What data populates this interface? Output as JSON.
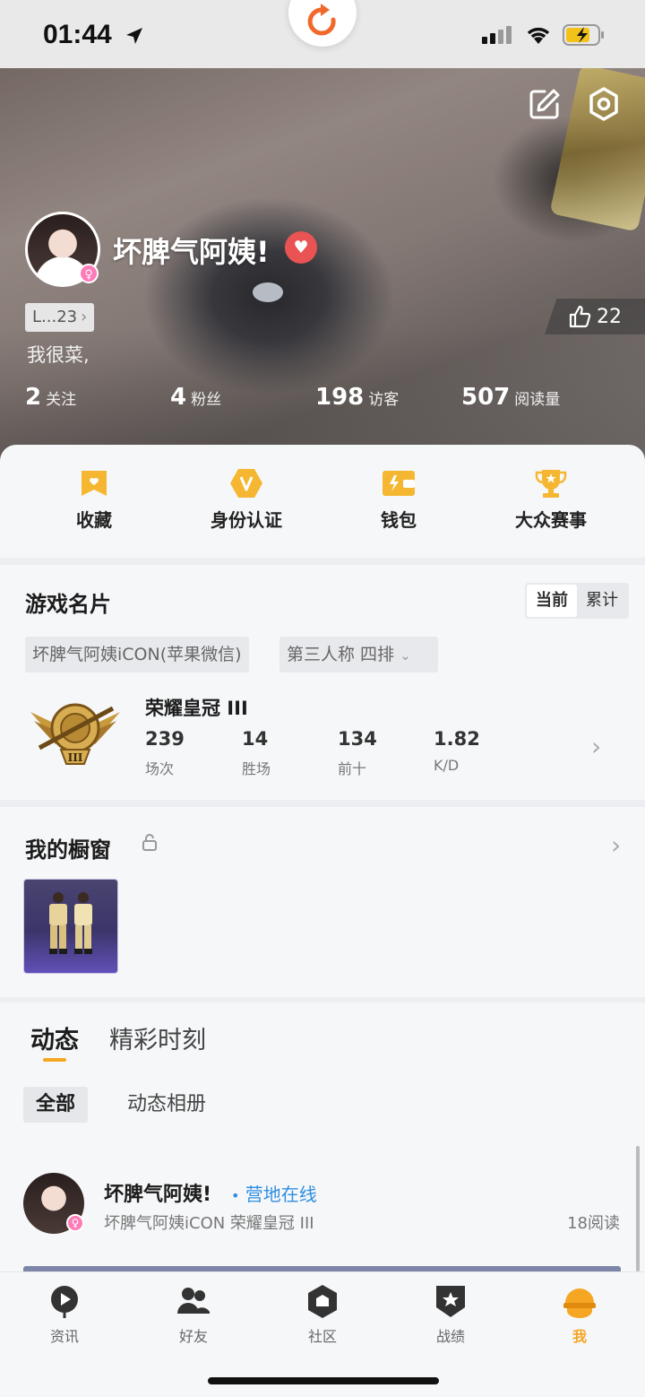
{
  "status_bar": {
    "time": "01:44"
  },
  "profile": {
    "username": "坏脾气阿姨!",
    "level": "L...23",
    "bio": "我很菜,",
    "likes": "22",
    "stats": [
      {
        "value": "2",
        "label": "关注"
      },
      {
        "value": "4",
        "label": "粉丝"
      },
      {
        "value": "198",
        "label": "访客"
      },
      {
        "value": "507",
        "label": "阅读量"
      }
    ]
  },
  "quick_actions": [
    {
      "label": "收藏",
      "icon": "bookmark-icon"
    },
    {
      "label": "身份认证",
      "icon": "verified-v-icon"
    },
    {
      "label": "钱包",
      "icon": "wallet-icon"
    },
    {
      "label": "大众赛事",
      "icon": "trophy-icon"
    }
  ],
  "game_card": {
    "title": "游戏名片",
    "toggle": [
      "当前",
      "累计"
    ],
    "account": "坏脾气阿姨iCON(苹果微信)",
    "mode": "第三人称 四排",
    "rank": "荣耀皇冠 III",
    "stats": [
      {
        "value": "239",
        "label": "场次"
      },
      {
        "value": "14",
        "label": "胜场"
      },
      {
        "value": "134",
        "label": "前十"
      },
      {
        "value": "1.82",
        "label": "K/D"
      }
    ]
  },
  "showcase": {
    "title": "我的橱窗"
  },
  "feed": {
    "tabs": [
      "动态",
      "精彩时刻"
    ],
    "subtabs": [
      "全部",
      "动态相册"
    ],
    "post": {
      "author": "坏脾气阿姨!",
      "online": "营地在线",
      "meta": "坏脾气阿姨iCON  荣耀皇冠 III",
      "reads": "18阅读"
    }
  },
  "tab_bar": [
    {
      "label": "资讯",
      "icon": "news-icon"
    },
    {
      "label": "好友",
      "icon": "friends-icon"
    },
    {
      "label": "社区",
      "icon": "community-icon"
    },
    {
      "label": "战绩",
      "icon": "record-icon"
    },
    {
      "label": "我",
      "icon": "me-icon",
      "active": true
    }
  ],
  "colors": {
    "accent": "#f5a623",
    "online_blue": "#2f8ee0",
    "heart_red": "#e95353",
    "gender_pink": "#ff7ab8"
  }
}
